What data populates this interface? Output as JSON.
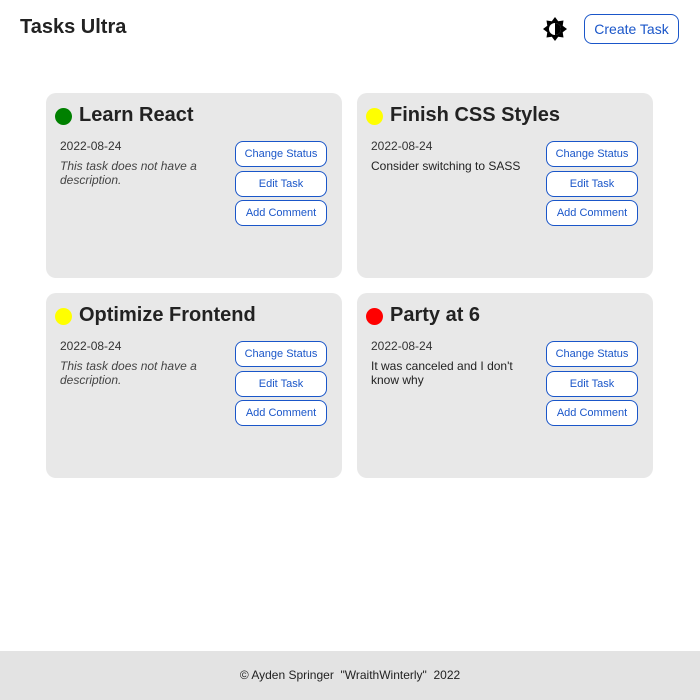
{
  "header": {
    "title": "Tasks Ultra",
    "theme_toggle_icon": "brightness-icon",
    "create_button_label": "Create Task"
  },
  "colors": {
    "accent": "#1a56c9",
    "card_background": "#e8e8e8",
    "footer_background": "#e3e3e3",
    "status_green": "#008000",
    "status_yellow": "#ffff00",
    "status_red": "#ff0000"
  },
  "tasks": [
    {
      "title": "Learn React",
      "date": "2022-08-24",
      "description": "This task does not have a description.",
      "has_description": false,
      "status_color": "#008000",
      "buttons": {
        "status": "Change Status",
        "edit": "Edit Task",
        "comment": "Add Comment"
      }
    },
    {
      "title": "Finish CSS Styles",
      "date": "2022-08-24",
      "description": "Consider switching to SASS",
      "has_description": true,
      "status_color": "#ffff00",
      "buttons": {
        "status": "Change Status",
        "edit": "Edit Task",
        "comment": "Add Comment"
      }
    },
    {
      "title": "Optimize Frontend",
      "date": "2022-08-24",
      "description": "This task does not have a description.",
      "has_description": false,
      "status_color": "#ffff00",
      "buttons": {
        "status": "Change Status",
        "edit": "Edit Task",
        "comment": "Add Comment"
      }
    },
    {
      "title": "Party at 6",
      "date": "2022-08-24",
      "description": "It was canceled and I don't know why",
      "has_description": true,
      "status_color": "#ff0000",
      "buttons": {
        "status": "Change Status",
        "edit": "Edit Task",
        "comment": "Add Comment"
      }
    }
  ],
  "footer": {
    "text": "© Ayden Springer  \"WraithWinterly\"  2022"
  }
}
